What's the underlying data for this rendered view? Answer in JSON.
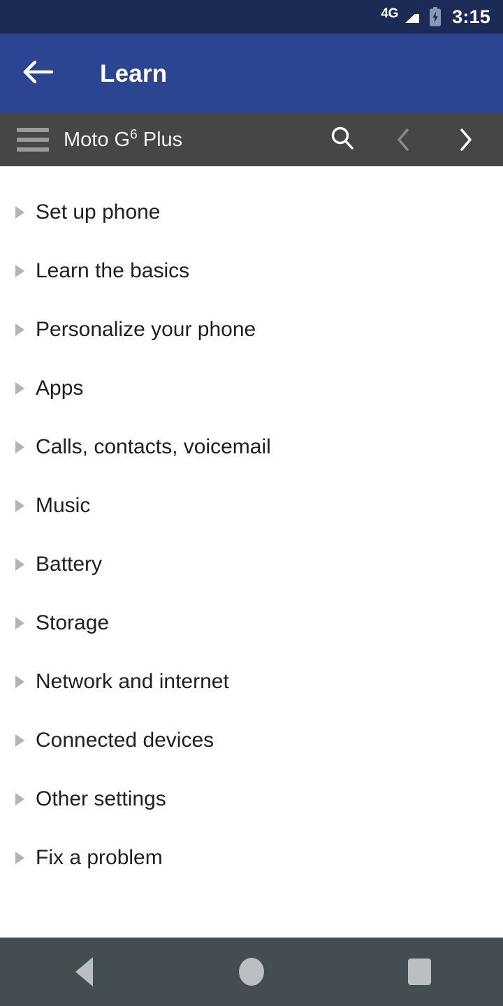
{
  "status_bar": {
    "network_label": "4G",
    "signal_icon": "signal-bars-full-icon",
    "battery_icon": "battery-charging-icon",
    "time": "3:15",
    "background_color": "#1C2B56"
  },
  "app_bar": {
    "back_icon": "arrow-left-icon",
    "title": "Learn",
    "background_color": "#2C4593",
    "text_color": "#FFFFFF"
  },
  "sub_bar": {
    "menu_icon": "hamburger-menu-icon",
    "device_name_prefix": "Moto G",
    "device_name_superscript": "6",
    "device_name_suffix": " Plus",
    "background_color": "#464646",
    "actions": [
      {
        "name": "search-icon",
        "label": "Search",
        "enabled": true
      },
      {
        "name": "chevron-left-icon",
        "label": "Previous",
        "enabled": false
      },
      {
        "name": "chevron-right-icon",
        "label": "Next",
        "enabled": true
      }
    ]
  },
  "content": {
    "bullet_icon": "triangle-right-bullet-icon",
    "bullet_color": "#B3B3B3",
    "items": [
      {
        "label": "Set up phone"
      },
      {
        "label": "Learn the basics"
      },
      {
        "label": "Personalize your phone"
      },
      {
        "label": "Apps"
      },
      {
        "label": "Calls, contacts, voicemail"
      },
      {
        "label": "Music"
      },
      {
        "label": "Battery"
      },
      {
        "label": "Storage"
      },
      {
        "label": "Network and internet"
      },
      {
        "label": "Connected devices"
      },
      {
        "label": "Other settings"
      },
      {
        "label": "Fix a problem"
      }
    ]
  },
  "nav_bar": {
    "background_color": "#434D52",
    "buttons": [
      {
        "name": "android-back-icon",
        "label": "Back"
      },
      {
        "name": "android-home-icon",
        "label": "Home"
      },
      {
        "name": "android-recents-icon",
        "label": "Recent apps"
      }
    ]
  }
}
